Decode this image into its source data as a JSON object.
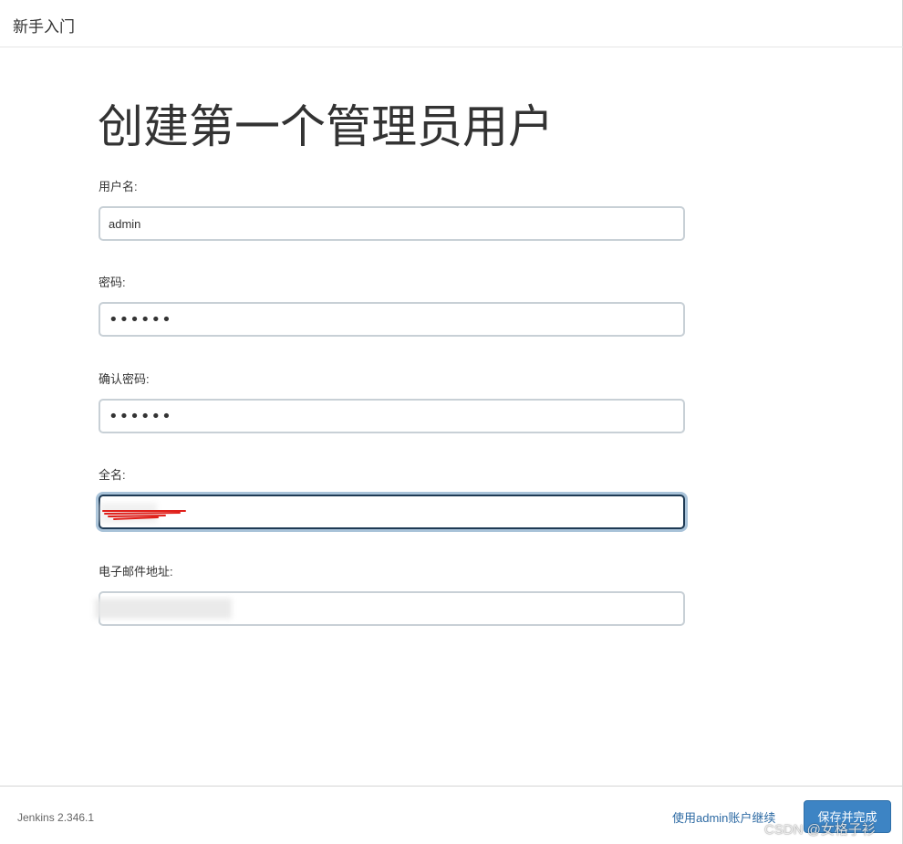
{
  "header": {
    "title": "新手入门"
  },
  "page": {
    "title": "创建第一个管理员用户"
  },
  "form": {
    "username": {
      "label": "用户名:",
      "value": "admin"
    },
    "password": {
      "label": "密码:",
      "value": "••••••"
    },
    "confirm_password": {
      "label": "确认密码:",
      "value": "••••••"
    },
    "full_name": {
      "label": "全名:",
      "value": ""
    },
    "email": {
      "label": "电子邮件地址:",
      "value": ""
    }
  },
  "footer": {
    "version": "Jenkins 2.346.1",
    "continue_link": "使用admin账户继续",
    "save_button": "保存并完成"
  },
  "watermark": {
    "text": "CSDN @女格子衫"
  },
  "colors": {
    "primary_button": "#3d84c4",
    "link": "#2d6aa3",
    "focus_border": "#1e3a54",
    "focus_ring": "#a9c3d9",
    "redaction_mark": "#e0201b"
  }
}
